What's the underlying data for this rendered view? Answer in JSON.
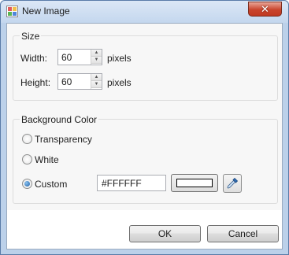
{
  "window": {
    "title": "New Image",
    "close_glyph": "✕"
  },
  "size_group": {
    "label": "Size",
    "width_label": "Width:",
    "width_value": "60",
    "height_label": "Height:",
    "height_value": "60",
    "unit": "pixels"
  },
  "background_group": {
    "label": "Background Color",
    "options": [
      {
        "label": "Transparency",
        "selected": false
      },
      {
        "label": "White",
        "selected": false
      },
      {
        "label": "Custom",
        "selected": true
      }
    ],
    "hex_value": "#FFFFFF",
    "swatch_color": "#FFFFFF",
    "picker_icon": "eyedropper-icon"
  },
  "buttons": {
    "ok": "OK",
    "cancel": "Cancel"
  },
  "colors": {
    "title_bar": "#c4d7ee",
    "close_button": "#c9452d",
    "accent": "#1f5fa6"
  }
}
